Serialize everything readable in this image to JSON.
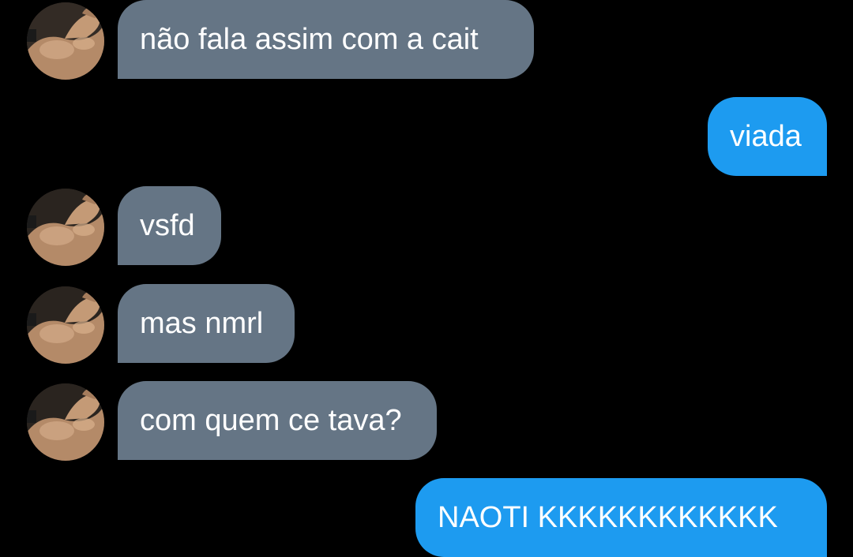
{
  "conversation": {
    "messages": [
      {
        "sender": "other",
        "text": "não fala assim com a cait",
        "avatar_icon": "flexed-arm-avatar"
      },
      {
        "sender": "me",
        "text": "viada"
      },
      {
        "sender": "other",
        "text": "vsfd",
        "avatar_icon": "flexed-arm-avatar"
      },
      {
        "sender": "other",
        "text": "mas nmrl",
        "avatar_icon": "flexed-arm-avatar"
      },
      {
        "sender": "other",
        "text": "com quem ce tava?",
        "avatar_icon": "flexed-arm-avatar"
      },
      {
        "sender": "me",
        "text": "NAOTI KKKKKKKKKKKK"
      }
    ]
  },
  "colors": {
    "background": "#000000",
    "incoming_bubble": "#657585",
    "outgoing_bubble": "#1d9bf0",
    "text": "#ffffff"
  }
}
